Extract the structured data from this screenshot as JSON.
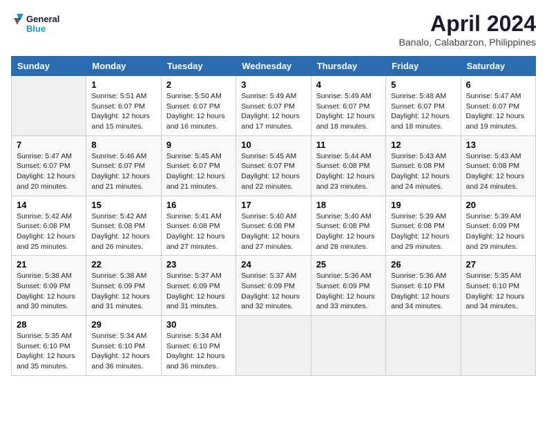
{
  "header": {
    "logo_line1": "General",
    "logo_line2": "Blue",
    "title": "April 2024",
    "subtitle": "Banalo, Calabarzon, Philippines"
  },
  "weekdays": [
    "Sunday",
    "Monday",
    "Tuesday",
    "Wednesday",
    "Thursday",
    "Friday",
    "Saturday"
  ],
  "weeks": [
    [
      {
        "day": "",
        "empty": true
      },
      {
        "day": "1",
        "sunrise": "Sunrise: 5:51 AM",
        "sunset": "Sunset: 6:07 PM",
        "daylight": "Daylight: 12 hours and 15 minutes."
      },
      {
        "day": "2",
        "sunrise": "Sunrise: 5:50 AM",
        "sunset": "Sunset: 6:07 PM",
        "daylight": "Daylight: 12 hours and 16 minutes."
      },
      {
        "day": "3",
        "sunrise": "Sunrise: 5:49 AM",
        "sunset": "Sunset: 6:07 PM",
        "daylight": "Daylight: 12 hours and 17 minutes."
      },
      {
        "day": "4",
        "sunrise": "Sunrise: 5:49 AM",
        "sunset": "Sunset: 6:07 PM",
        "daylight": "Daylight: 12 hours and 18 minutes."
      },
      {
        "day": "5",
        "sunrise": "Sunrise: 5:48 AM",
        "sunset": "Sunset: 6:07 PM",
        "daylight": "Daylight: 12 hours and 18 minutes."
      },
      {
        "day": "6",
        "sunrise": "Sunrise: 5:47 AM",
        "sunset": "Sunset: 6:07 PM",
        "daylight": "Daylight: 12 hours and 19 minutes."
      }
    ],
    [
      {
        "day": "7",
        "sunrise": "Sunrise: 5:47 AM",
        "sunset": "Sunset: 6:07 PM",
        "daylight": "Daylight: 12 hours and 20 minutes."
      },
      {
        "day": "8",
        "sunrise": "Sunrise: 5:46 AM",
        "sunset": "Sunset: 6:07 PM",
        "daylight": "Daylight: 12 hours and 21 minutes."
      },
      {
        "day": "9",
        "sunrise": "Sunrise: 5:45 AM",
        "sunset": "Sunset: 6:07 PM",
        "daylight": "Daylight: 12 hours and 21 minutes."
      },
      {
        "day": "10",
        "sunrise": "Sunrise: 5:45 AM",
        "sunset": "Sunset: 6:07 PM",
        "daylight": "Daylight: 12 hours and 22 minutes."
      },
      {
        "day": "11",
        "sunrise": "Sunrise: 5:44 AM",
        "sunset": "Sunset: 6:08 PM",
        "daylight": "Daylight: 12 hours and 23 minutes."
      },
      {
        "day": "12",
        "sunrise": "Sunrise: 5:43 AM",
        "sunset": "Sunset: 6:08 PM",
        "daylight": "Daylight: 12 hours and 24 minutes."
      },
      {
        "day": "13",
        "sunrise": "Sunrise: 5:43 AM",
        "sunset": "Sunset: 6:08 PM",
        "daylight": "Daylight: 12 hours and 24 minutes."
      }
    ],
    [
      {
        "day": "14",
        "sunrise": "Sunrise: 5:42 AM",
        "sunset": "Sunset: 6:08 PM",
        "daylight": "Daylight: 12 hours and 25 minutes."
      },
      {
        "day": "15",
        "sunrise": "Sunrise: 5:42 AM",
        "sunset": "Sunset: 6:08 PM",
        "daylight": "Daylight: 12 hours and 26 minutes."
      },
      {
        "day": "16",
        "sunrise": "Sunrise: 5:41 AM",
        "sunset": "Sunset: 6:08 PM",
        "daylight": "Daylight: 12 hours and 27 minutes."
      },
      {
        "day": "17",
        "sunrise": "Sunrise: 5:40 AM",
        "sunset": "Sunset: 6:08 PM",
        "daylight": "Daylight: 12 hours and 27 minutes."
      },
      {
        "day": "18",
        "sunrise": "Sunrise: 5:40 AM",
        "sunset": "Sunset: 6:08 PM",
        "daylight": "Daylight: 12 hours and 28 minutes."
      },
      {
        "day": "19",
        "sunrise": "Sunrise: 5:39 AM",
        "sunset": "Sunset: 6:08 PM",
        "daylight": "Daylight: 12 hours and 29 minutes."
      },
      {
        "day": "20",
        "sunrise": "Sunrise: 5:39 AM",
        "sunset": "Sunset: 6:09 PM",
        "daylight": "Daylight: 12 hours and 29 minutes."
      }
    ],
    [
      {
        "day": "21",
        "sunrise": "Sunrise: 5:38 AM",
        "sunset": "Sunset: 6:09 PM",
        "daylight": "Daylight: 12 hours and 30 minutes."
      },
      {
        "day": "22",
        "sunrise": "Sunrise: 5:38 AM",
        "sunset": "Sunset: 6:09 PM",
        "daylight": "Daylight: 12 hours and 31 minutes."
      },
      {
        "day": "23",
        "sunrise": "Sunrise: 5:37 AM",
        "sunset": "Sunset: 6:09 PM",
        "daylight": "Daylight: 12 hours and 31 minutes."
      },
      {
        "day": "24",
        "sunrise": "Sunrise: 5:37 AM",
        "sunset": "Sunset: 6:09 PM",
        "daylight": "Daylight: 12 hours and 32 minutes."
      },
      {
        "day": "25",
        "sunrise": "Sunrise: 5:36 AM",
        "sunset": "Sunset: 6:09 PM",
        "daylight": "Daylight: 12 hours and 33 minutes."
      },
      {
        "day": "26",
        "sunrise": "Sunrise: 5:36 AM",
        "sunset": "Sunset: 6:10 PM",
        "daylight": "Daylight: 12 hours and 34 minutes."
      },
      {
        "day": "27",
        "sunrise": "Sunrise: 5:35 AM",
        "sunset": "Sunset: 6:10 PM",
        "daylight": "Daylight: 12 hours and 34 minutes."
      }
    ],
    [
      {
        "day": "28",
        "sunrise": "Sunrise: 5:35 AM",
        "sunset": "Sunset: 6:10 PM",
        "daylight": "Daylight: 12 hours and 35 minutes."
      },
      {
        "day": "29",
        "sunrise": "Sunrise: 5:34 AM",
        "sunset": "Sunset: 6:10 PM",
        "daylight": "Daylight: 12 hours and 36 minutes."
      },
      {
        "day": "30",
        "sunrise": "Sunrise: 5:34 AM",
        "sunset": "Sunset: 6:10 PM",
        "daylight": "Daylight: 12 hours and 36 minutes."
      },
      {
        "day": "",
        "empty": true
      },
      {
        "day": "",
        "empty": true
      },
      {
        "day": "",
        "empty": true
      },
      {
        "day": "",
        "empty": true
      }
    ]
  ]
}
